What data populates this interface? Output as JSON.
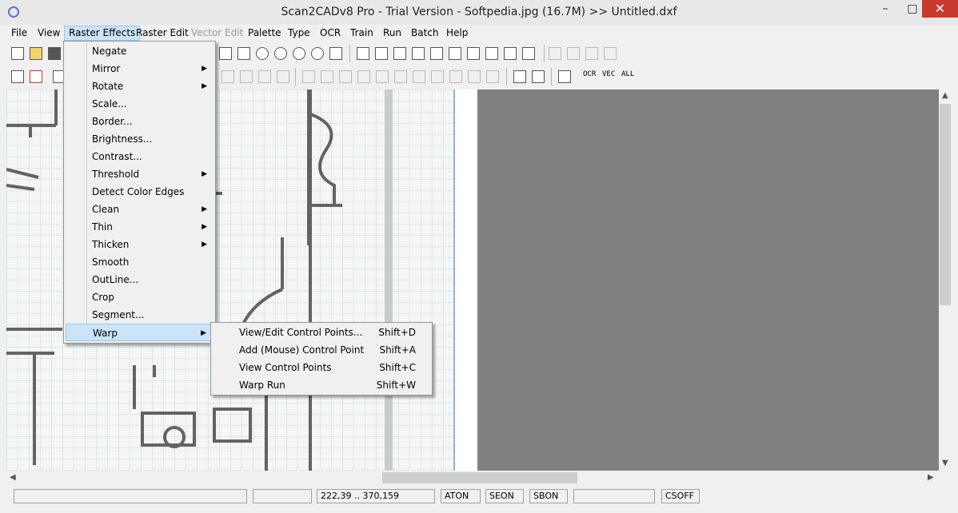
{
  "window": {
    "title": "Scan2CADv8 Pro - Trial Version  -  Softpedia.jpg (16.7M) >> Untitled.dxf",
    "minimize": "–",
    "maximize": "□",
    "close": "✕"
  },
  "menubar": [
    {
      "label": "File"
    },
    {
      "label": "View"
    },
    {
      "label": "Raster Effects"
    },
    {
      "label": "Raster Edit"
    },
    {
      "label": "Vector Edit"
    },
    {
      "label": "Palette"
    },
    {
      "label": "Type"
    },
    {
      "label": "OCR"
    },
    {
      "label": "Train"
    },
    {
      "label": "Run"
    },
    {
      "label": "Batch"
    },
    {
      "label": "Help"
    }
  ],
  "raster_menu": {
    "items": [
      {
        "label": "Negate"
      },
      {
        "label": "Mirror"
      },
      {
        "label": "Rotate"
      },
      {
        "label": "Scale..."
      },
      {
        "label": "Border..."
      },
      {
        "label": "Brightness..."
      },
      {
        "label": "Contrast..."
      },
      {
        "label": "Threshold"
      },
      {
        "label": "Detect Color Edges"
      },
      {
        "label": "Clean"
      },
      {
        "label": "Thin"
      },
      {
        "label": "Thicken"
      },
      {
        "label": "Smooth"
      },
      {
        "label": "OutLine..."
      },
      {
        "label": "Crop"
      },
      {
        "label": "Segment..."
      },
      {
        "label": "Warp"
      }
    ],
    "submenu_arrow": "▶"
  },
  "warp_menu": {
    "items": [
      {
        "label": "View/Edit Control Points...",
        "shortcut": "Shift+D"
      },
      {
        "label": "Add (Mouse) Control Point",
        "shortcut": "Shift+A"
      },
      {
        "label": "View Control Points",
        "shortcut": "Shift+C"
      },
      {
        "label": "Warp Run",
        "shortcut": "Shift+W"
      }
    ]
  },
  "toolbar2_text": {
    "ocr": "OCR",
    "vec": "VEC",
    "all": "ALL"
  },
  "statusbar": {
    "coords": "222,39 .. 370,159",
    "aton": "ATON",
    "seon": "SEON",
    "sbon": "SBON",
    "csoff": "CSOFF"
  },
  "scroll": {
    "up": "▲",
    "down": "▼",
    "left": "◀",
    "right": "▶"
  },
  "colors": {
    "accent_highlight": "#cce4f7",
    "close_button": "#c7392b",
    "canvas_gray": "#808080"
  }
}
